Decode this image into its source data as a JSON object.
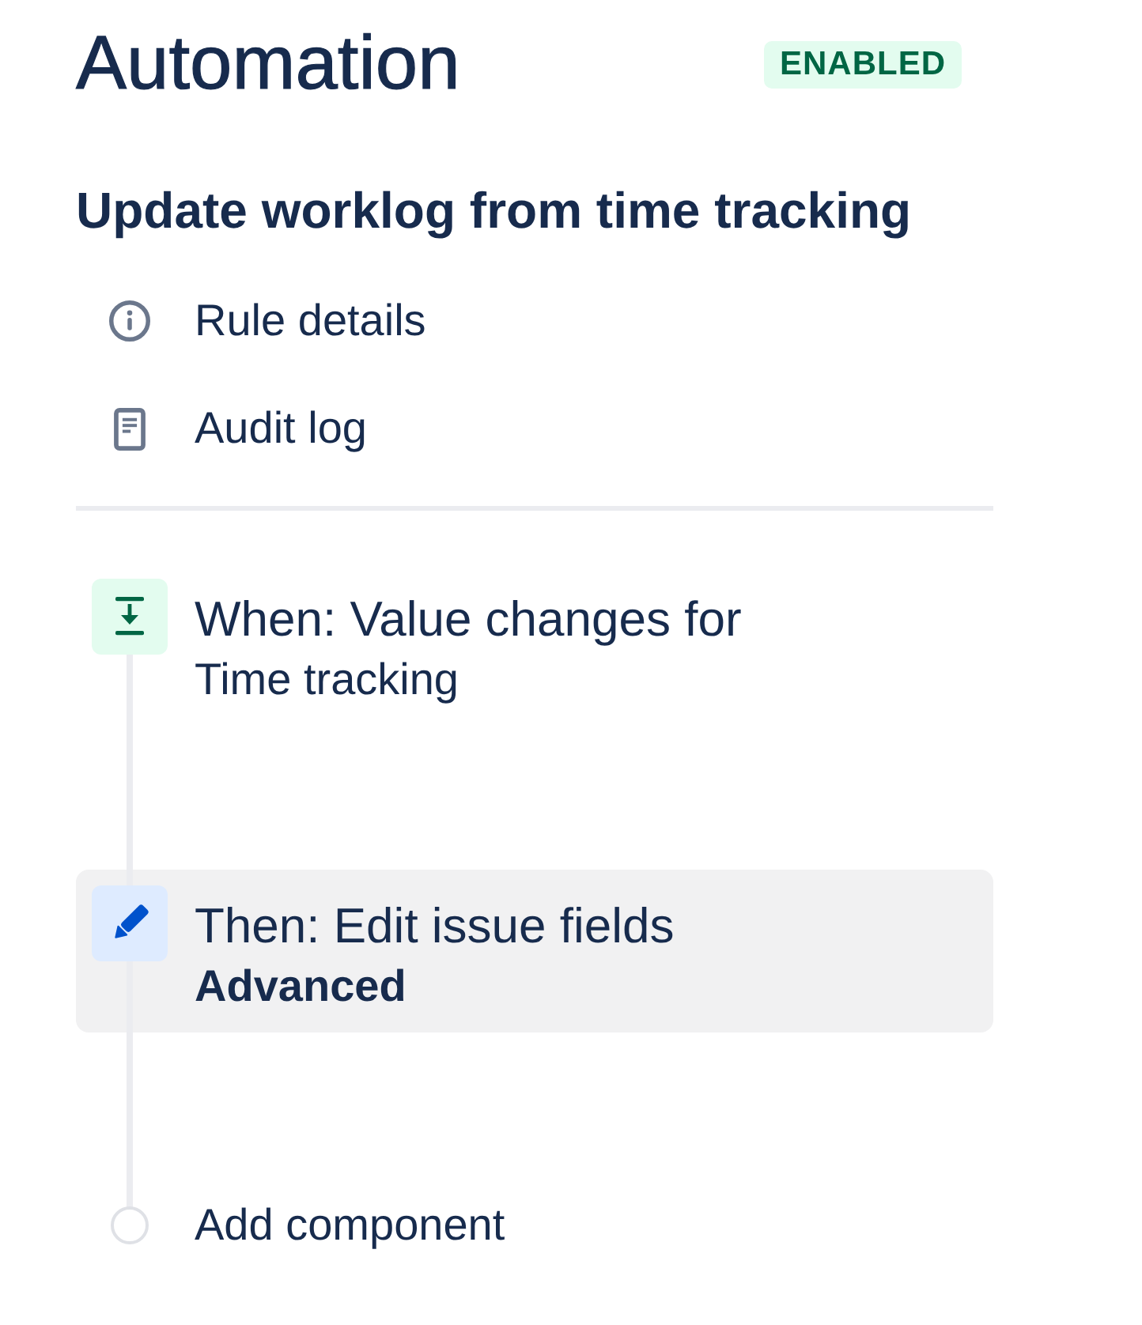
{
  "header": {
    "title": "Automation",
    "status": {
      "label": "ENABLED",
      "enabled": true
    }
  },
  "rule": {
    "name": "Update worklog from time tracking"
  },
  "nav": [
    {
      "label": "Rule details",
      "kind": "info"
    },
    {
      "label": "Audit log",
      "kind": "log"
    }
  ],
  "components": [
    {
      "kind": "trigger",
      "title": "When: Value changes for",
      "detail": "Time tracking",
      "selected": false
    },
    {
      "kind": "action",
      "title": "Then: Edit issue fields",
      "detail": "Advanced",
      "selected": true
    }
  ],
  "add_component": {
    "label": "Add component"
  }
}
